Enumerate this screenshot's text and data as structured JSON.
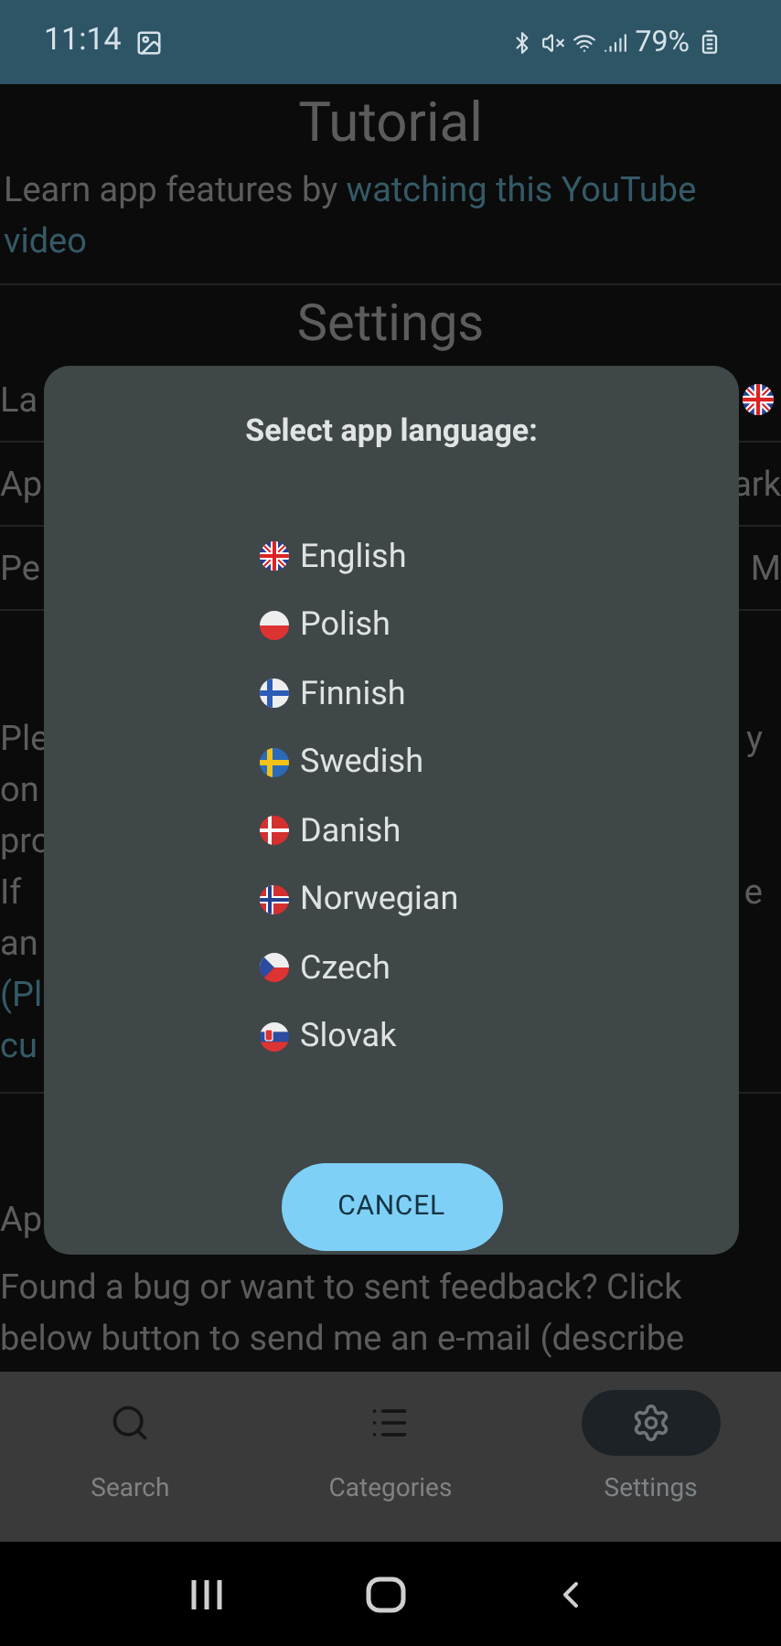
{
  "status_bar": {
    "time": "11:14",
    "battery": "79%"
  },
  "background": {
    "title": "Tutorial",
    "intro": "Learn app features by ",
    "intro_link": "watching this YouTube video",
    "section_title": "Settings",
    "settings_rows": [
      {
        "left": "La",
        "kind": "flag"
      },
      {
        "left": "Ap",
        "kind": "text",
        "right": "ark"
      },
      {
        "left": "Pe",
        "kind": "text",
        "right": "M"
      }
    ],
    "paragraph_lines": [
      {
        "left": "Ple",
        "right": "y",
        "kind": "text"
      },
      {
        "left": "on",
        "kind": "text"
      },
      {
        "left": "pro",
        "kind": "text"
      },
      {
        "left": "If",
        "right": "e",
        "kind": "text"
      },
      {
        "left": "an",
        "kind": "text"
      },
      {
        "left": "(Pl",
        "kind": "link"
      },
      {
        "left": "cu",
        "kind": "link"
      }
    ],
    "about_fragment": "Ap",
    "feedback_lines": [
      "Found a bug or want to sent feedback? Click",
      "below button to send me an e-mail (describe"
    ]
  },
  "dialog": {
    "title": "Select app language:",
    "languages": [
      {
        "label": "English",
        "kind": "gb"
      },
      {
        "label": "Polish",
        "kind": "pl"
      },
      {
        "label": "Finnish",
        "kind": "fi"
      },
      {
        "label": "Swedish",
        "kind": "se"
      },
      {
        "label": "Danish",
        "kind": "dk"
      },
      {
        "label": "Norwegian",
        "kind": "no"
      },
      {
        "label": "Czech",
        "kind": "cz"
      },
      {
        "label": "Slovak",
        "kind": "sk"
      }
    ],
    "cancel": "CANCEL"
  },
  "bottom_nav": [
    {
      "label": "Search",
      "kind": "search",
      "selected": false
    },
    {
      "label": "Categories",
      "kind": "list",
      "selected": false
    },
    {
      "label": "Settings",
      "kind": "settings",
      "selected": true
    }
  ]
}
